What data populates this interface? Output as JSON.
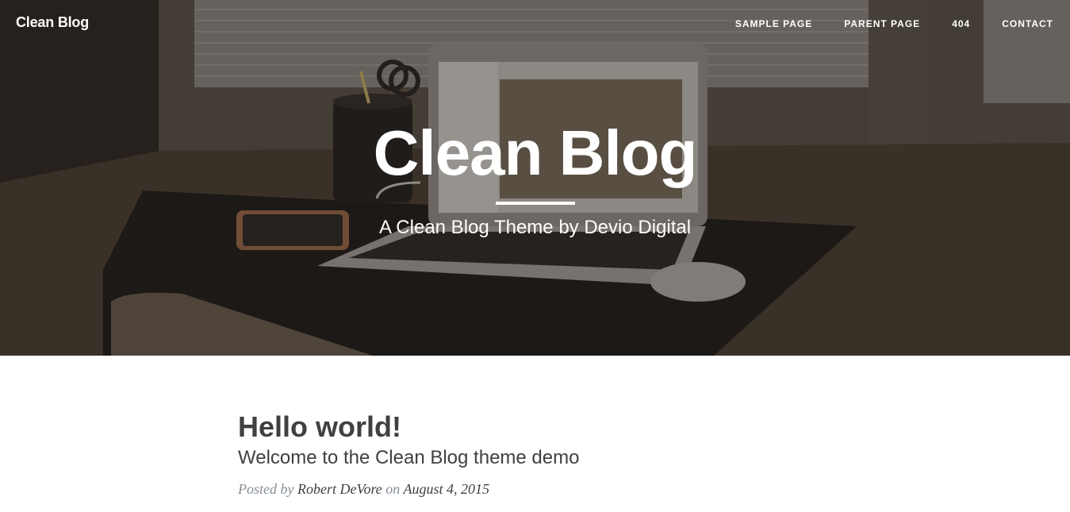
{
  "nav": {
    "brand": "Clean Blog",
    "links": [
      {
        "label": "SAMPLE PAGE"
      },
      {
        "label": "PARENT PAGE"
      },
      {
        "label": "404"
      },
      {
        "label": "CONTACT"
      }
    ]
  },
  "hero": {
    "title": "Clean Blog",
    "subtitle": "A Clean Blog Theme by Devio Digital"
  },
  "post": {
    "title": "Hello world!",
    "subtitle": "Welcome to the Clean Blog theme demo",
    "meta_prefix": "Posted by",
    "author": "Robert DeVore",
    "meta_on": "on",
    "date": "August 4, 2015"
  }
}
